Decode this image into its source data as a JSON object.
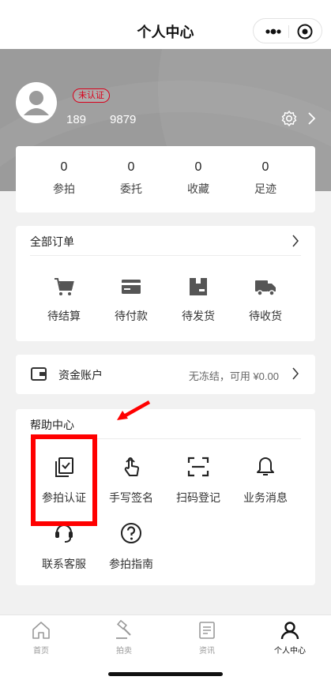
{
  "nav": {
    "title": "个人中心"
  },
  "profile": {
    "badge": "未认证",
    "phone": "189    9879"
  },
  "stats": [
    {
      "value": "0",
      "label": "参拍"
    },
    {
      "value": "0",
      "label": "委托"
    },
    {
      "value": "0",
      "label": "收藏"
    },
    {
      "value": "0",
      "label": "足迹"
    }
  ],
  "orders": {
    "title": "全部订单",
    "items": [
      {
        "label": "待结算",
        "icon": "cart-icon"
      },
      {
        "label": "待付款",
        "icon": "card-icon"
      },
      {
        "label": "待发货",
        "icon": "package-icon"
      },
      {
        "label": "待收货",
        "icon": "truck-icon"
      }
    ]
  },
  "fund": {
    "label": "资金账户",
    "info": "无冻结，可用 ¥0.00"
  },
  "help": {
    "title": "帮助中心",
    "items": [
      {
        "label": "参拍认证",
        "icon": "verify-icon"
      },
      {
        "label": "手写签名",
        "icon": "hand-sign-icon"
      },
      {
        "label": "扫码登记",
        "icon": "scan-icon"
      },
      {
        "label": "业务消息",
        "icon": "bell-icon"
      },
      {
        "label": "联系客服",
        "icon": "headset-icon"
      },
      {
        "label": "参拍指南",
        "icon": "question-icon"
      }
    ]
  },
  "tabbar": [
    {
      "label": "首页",
      "icon": "home-icon",
      "active": false
    },
    {
      "label": "拍卖",
      "icon": "gavel-icon",
      "active": false
    },
    {
      "label": "资讯",
      "icon": "news-icon",
      "active": false
    },
    {
      "label": "个人中心",
      "icon": "user-icon",
      "active": true
    }
  ],
  "colors": {
    "accent_red": "#d9001b",
    "annotation_red": "#ff0000",
    "header_gray": "#9b9b9b"
  }
}
